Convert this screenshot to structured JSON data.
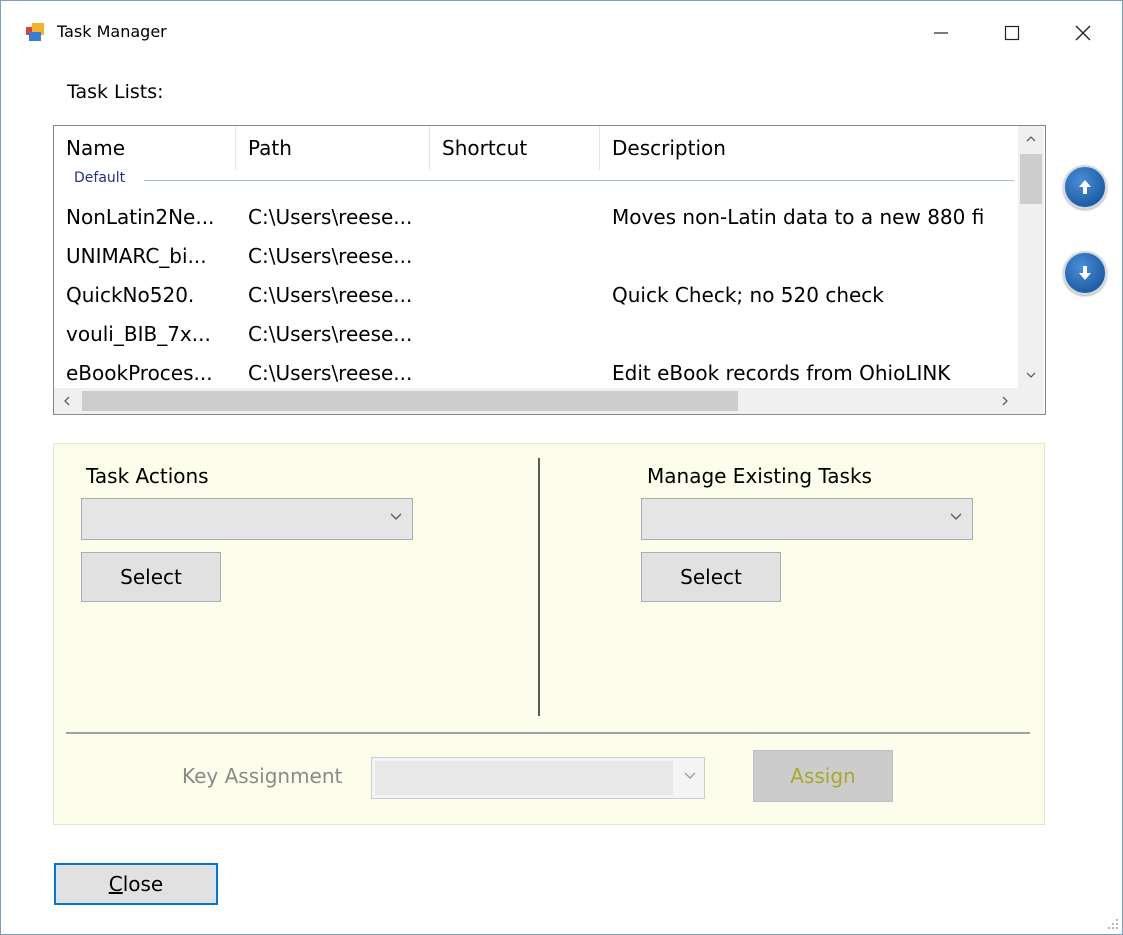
{
  "window": {
    "title": "Task Manager"
  },
  "task_lists": {
    "label": "Task Lists:",
    "columns": [
      "Name",
      "Path",
      "Shortcut",
      "Description"
    ],
    "group": "Default",
    "rows": [
      {
        "name": "NonLatin2Ne...",
        "path": "C:\\Users\\reese...",
        "shortcut": "",
        "description": "Moves non-Latin data to a new 880 fi"
      },
      {
        "name": "UNIMARC_bi...",
        "path": "C:\\Users\\reese...",
        "shortcut": "",
        "description": ""
      },
      {
        "name": "QuickNo520.",
        "path": "C:\\Users\\reese...",
        "shortcut": "",
        "description": "Quick Check; no 520 check"
      },
      {
        "name": "vouli_BIB_7x...",
        "path": "C:\\Users\\reese...",
        "shortcut": "",
        "description": ""
      },
      {
        "name": "eBookProces...",
        "path": "C:\\Users\\reese...",
        "shortcut": "",
        "description": "Edit eBook records from OhioLINK"
      }
    ]
  },
  "task_actions": {
    "heading": "Task Actions",
    "select_value": "",
    "button": "Select"
  },
  "manage_tasks": {
    "heading": "Manage Existing Tasks",
    "select_value": "",
    "button": "Select"
  },
  "key_assignment": {
    "label": "Key Assignment",
    "value": "",
    "button": "Assign"
  },
  "footer": {
    "close_mnemonic": "C",
    "close_rest": "lose"
  },
  "icons": [
    "app-icon",
    "minimize-icon",
    "maximize-icon",
    "close-icon",
    "arrow-up-icon",
    "arrow-down-icon",
    "chevron-down-icon",
    "resize-grip-icon"
  ]
}
